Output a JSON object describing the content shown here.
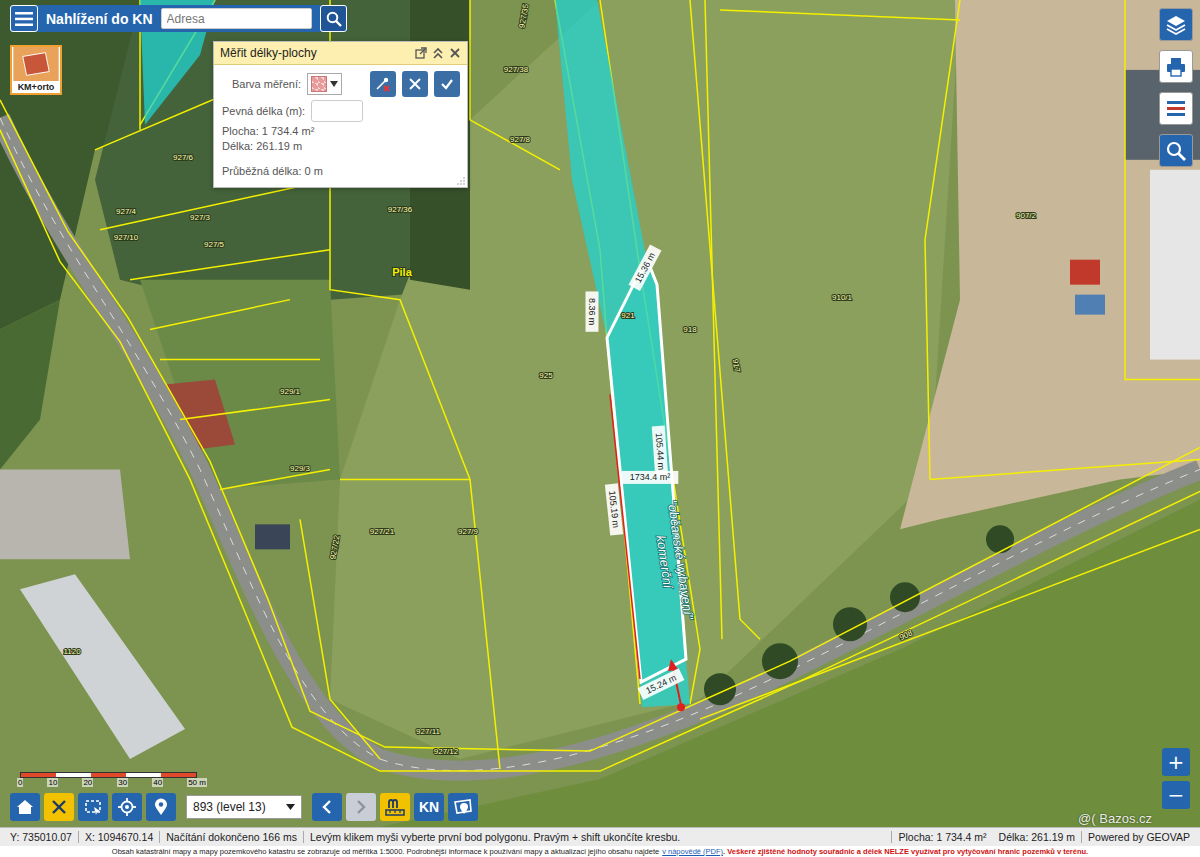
{
  "header": {
    "title": "Nahlížení do KN",
    "search_placeholder": "Adresa"
  },
  "layer_switch": {
    "label": "KM+orto"
  },
  "measure_panel": {
    "title": "Měřit délky-plochy",
    "color_label": "Barva měření:",
    "color": "#e89a9a",
    "fixed_length_label": "Pevná délka (m):",
    "area": "Plocha: 1 734.4 m²",
    "length": "Délka: 261.19 m",
    "running_length": "Průběžná délka: 0 m",
    "buttons": [
      {
        "kind": "remove-point"
      },
      {
        "kind": "cancel"
      },
      {
        "kind": "confirm"
      }
    ]
  },
  "map": {
    "place_label": "Pila",
    "parcels": [
      "927/35",
      "927/38",
      "927/8",
      "927/6",
      "927/36",
      "927/3",
      "927/4",
      "927/10",
      "927/5",
      "925",
      "921",
      "918",
      "917",
      "910/1",
      "907/2",
      "929/1",
      "929/3",
      "927/21",
      "927/9",
      "927/22",
      "927/11",
      "927/12",
      "1120",
      "908"
    ],
    "measurements": [
      "15.36 m",
      "8.36 m",
      "105.19 m",
      "105.44 m",
      "1734.4 m²",
      "15.24 m"
    ],
    "zoning_note": [
      "\"občanské vybavení\"",
      "komerční"
    ]
  },
  "scale": {
    "ticks": [
      "0",
      "10",
      "20",
      "30",
      "40",
      "50 m"
    ]
  },
  "right_tools": [
    {
      "kind": "layers",
      "selected": true
    },
    {
      "kind": "print",
      "selected": false
    },
    {
      "kind": "legend",
      "selected": false
    },
    {
      "kind": "search",
      "selected": true
    }
  ],
  "zoom": [
    "+",
    "−"
  ],
  "toolbar": [
    {
      "kind": "home",
      "label": "",
      "selected": false,
      "disabled": false
    },
    {
      "kind": "clear",
      "label": "",
      "selected": true,
      "disabled": false
    },
    {
      "kind": "select-area",
      "label": "",
      "selected": false,
      "disabled": false
    },
    {
      "kind": "locate",
      "label": "",
      "selected": false,
      "disabled": false
    },
    {
      "kind": "place",
      "label": "",
      "selected": false,
      "disabled": false
    },
    {
      "kind": "level-select",
      "label": "893 (level 13)",
      "selected": false,
      "disabled": false
    },
    {
      "kind": "back",
      "label": "",
      "selected": false,
      "disabled": false
    },
    {
      "kind": "forward",
      "label": "",
      "selected": false,
      "disabled": true
    },
    {
      "kind": "measure",
      "label": "",
      "selected": true,
      "disabled": false
    },
    {
      "kind": "text",
      "label": "KN",
      "selected": false,
      "disabled": false
    },
    {
      "kind": "parcel-info",
      "label": "",
      "selected": false,
      "disabled": false
    }
  ],
  "status": {
    "y": "Y: 735010.07",
    "x": "X: 1094670.14",
    "load": "Načítání dokončeno 166 ms",
    "hint": "Levým klikem myši vyberte první bod polygonu. Pravým + shift ukončíte kresbu.",
    "area": "Plocha: 1 734.4 m²",
    "length": "Délka: 261.19 m",
    "powered": "Powered by GEOVAP"
  },
  "footer": {
    "text": "Obsah katastrální mapy a mapy pozemkového katastru se zobrazuje od měřítka 1:5000. Podrobnější informace k používání mapy a aktualizaci jejího obsahu najdete",
    "link": "v nápovědě (PDF)",
    "warning": ". Veškeré zjištěné hodnoty souřadnic a délek NELZE využívat pro vytyčování hranic pozemků v terénu."
  },
  "watermark": "@( Bazos.cz"
}
